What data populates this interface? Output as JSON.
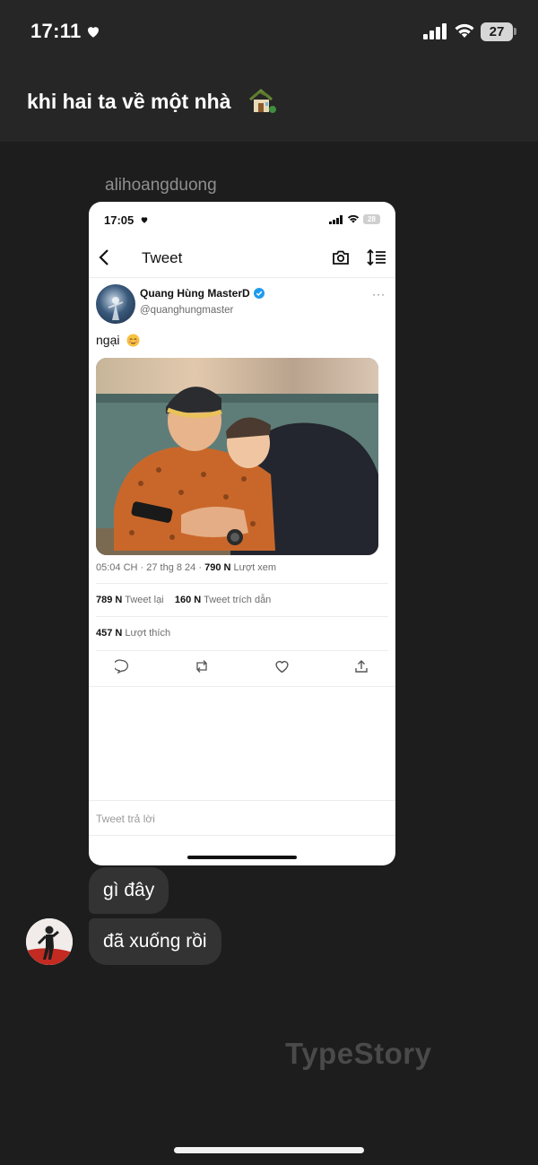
{
  "status_bar": {
    "time": "17:11",
    "battery": "27"
  },
  "chat": {
    "title": "khi hai ta về một nhà",
    "sender": "alihoangduong"
  },
  "shared_screenshot": {
    "status_time": "17:05",
    "battery": "28",
    "header_title": "Tweet",
    "author_name": "Quang Hùng MasterD",
    "author_handle": "@quanghungmaster",
    "more": "···",
    "tweet_text": "ngại",
    "meta": {
      "time_date": "05:04 CH · 27 thg 8 24 ·",
      "views_count": "790 N",
      "views_label": "Lượt xem"
    },
    "retweets": {
      "count": "789 N",
      "label": "Tweet lại"
    },
    "quotes": {
      "count": "160 N",
      "label": "Tweet trích dẫn"
    },
    "likes": {
      "count": "457 N",
      "label": "Lượt thích"
    },
    "reply_placeholder": "Tweet trả lời"
  },
  "messages": [
    {
      "text": "gì đây"
    },
    {
      "text": "đã xuống rồi"
    }
  ],
  "watermark": "TypeStory"
}
